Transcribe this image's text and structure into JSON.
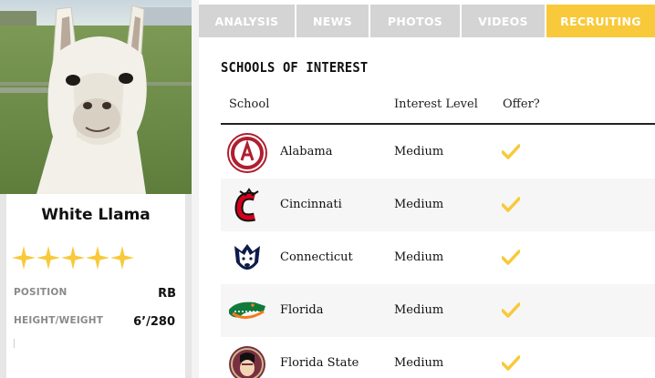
{
  "player": {
    "name": "White Llama",
    "rating_stars": 5,
    "stats": [
      {
        "label": "POSITION",
        "value": "RB"
      },
      {
        "label": "HEIGHT/WEIGHT",
        "value": "6’/280"
      }
    ]
  },
  "tabs": [
    {
      "label": "ANALYSIS",
      "active": false
    },
    {
      "label": "NEWS",
      "active": false
    },
    {
      "label": "PHOTOS",
      "active": false
    },
    {
      "label": "VIDEOS",
      "active": false
    },
    {
      "label": "RECRUITING",
      "active": true
    }
  ],
  "recruiting": {
    "title": "SCHOOLS OF INTEREST",
    "columns": {
      "school": "School",
      "interest": "Interest Level",
      "offer": "Offer?"
    },
    "rows": [
      {
        "school": "Alabama",
        "interest": "Medium",
        "offer": true,
        "logo": "alabama-logo-icon"
      },
      {
        "school": "Cincinnati",
        "interest": "Medium",
        "offer": true,
        "logo": "cincinnati-logo-icon"
      },
      {
        "school": "Connecticut",
        "interest": "Medium",
        "offer": true,
        "logo": "connecticut-logo-icon"
      },
      {
        "school": "Florida",
        "interest": "Medium",
        "offer": true,
        "logo": "florida-logo-icon"
      },
      {
        "school": "Florida State",
        "interest": "Medium",
        "offer": true,
        "logo": "florida-state-logo-icon"
      }
    ]
  },
  "colors": {
    "accent": "#f8c93a",
    "tab_inactive": "#d4d4d4",
    "text": "#111111"
  }
}
